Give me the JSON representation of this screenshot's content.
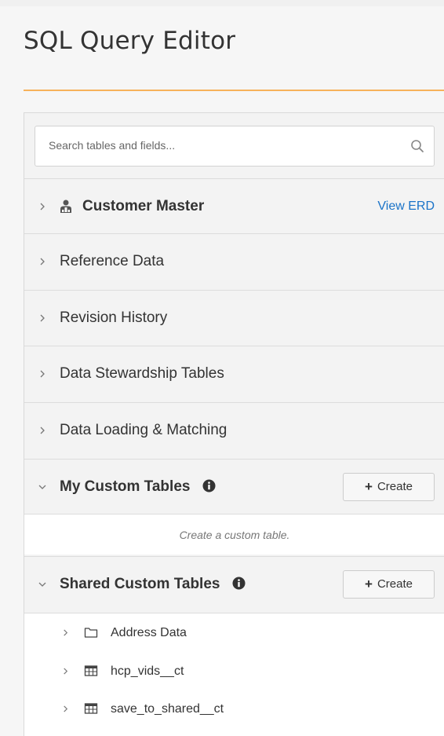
{
  "page": {
    "title": "SQL Query Editor"
  },
  "search": {
    "placeholder": "Search tables and fields...",
    "value": "",
    "icon": "search-icon"
  },
  "sections": [
    {
      "label": "Customer Master",
      "state": "collapsed",
      "icon": "customer-master-icon",
      "action": "View ERD"
    },
    {
      "label": "Reference Data",
      "state": "collapsed"
    },
    {
      "label": "Revision History",
      "state": "collapsed"
    },
    {
      "label": "Data Stewardship Tables",
      "state": "collapsed"
    },
    {
      "label": "Data Loading & Matching",
      "state": "collapsed"
    },
    {
      "label": "My Custom Tables",
      "state": "expanded",
      "icon": "info-icon",
      "create_icon": "+",
      "create_label": "Create",
      "empty_text": "Create a custom table."
    },
    {
      "label": "Shared Custom Tables",
      "state": "expanded",
      "icon": "info-icon",
      "create_icon": "+",
      "create_label": "Create"
    }
  ],
  "shared_items": [
    {
      "label": "Address Data",
      "icon": "folder-icon"
    },
    {
      "label": "hcp_vids__ct",
      "icon": "table-icon"
    },
    {
      "label": "save_to_shared__ct",
      "icon": "table-icon"
    }
  ],
  "colors": {
    "accent": "#f7b25b",
    "link": "#1a73c8"
  }
}
